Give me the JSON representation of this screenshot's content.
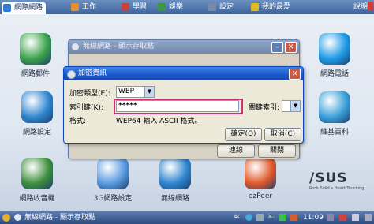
{
  "tabs": [
    {
      "label": "網際網路",
      "active": true,
      "icon_color": "#2e7bd6"
    },
    {
      "label": "工作",
      "active": false,
      "icon_color": "#e78d2a"
    },
    {
      "label": "學習",
      "active": false,
      "icon_color": "#c9403f"
    },
    {
      "label": "娛樂",
      "active": false,
      "icon_color": "#3b9a3f"
    },
    {
      "label": "設定",
      "active": false,
      "icon_color": "#7a88a8"
    },
    {
      "label": "我的最愛",
      "active": false,
      "icon_color": "#e6b821"
    }
  ],
  "help_label": "說明",
  "desktop_apps": [
    {
      "label": "網路郵件",
      "icon": "mail-icon",
      "color": "#3aa34a"
    },
    {
      "label": "網路設定",
      "icon": "network-globe-icon",
      "color": "#2f86d0"
    },
    {
      "label": "網路收音機",
      "icon": "radio-globe-icon",
      "color": "#3d8f3d"
    },
    {
      "label": "3G網路設定",
      "icon": "3g-globe-icon",
      "color": "#5a9be0"
    },
    {
      "label": "無線網路",
      "icon": "wireless-globe-icon",
      "color": "#2f86d0"
    },
    {
      "label": "ezPeer",
      "icon": "ezpeer-icon",
      "color": "#e0582a"
    },
    {
      "label": "網路電話",
      "icon": "skype-icon",
      "color": "#1d9ae6"
    },
    {
      "label": "維基百科",
      "icon": "book-icon",
      "color": "#3aa0d8"
    }
  ],
  "bg_window": {
    "title": "無線網路 - 顯示存取點",
    "connect_label": "連線",
    "close_label": "關閉"
  },
  "dialog": {
    "title": "加密資訊",
    "encryption_type_label": "加密類型(E):",
    "encryption_type_value": "WEP",
    "key_label": "索引鍵(K):",
    "key_value": "*****",
    "key_index_label": "關鍵索引:",
    "format_label": "格式:",
    "format_value": "WEP64 輸入 ASCII 格式。",
    "ok_label": "確定(O)",
    "cancel_label": "取消(C)"
  },
  "brand": {
    "name": "/SUS",
    "tagline": "Rock Solid • Heart Touching"
  },
  "taskbar": {
    "window_label": "無線網路 - 顯示存取點",
    "time": "11:09"
  }
}
